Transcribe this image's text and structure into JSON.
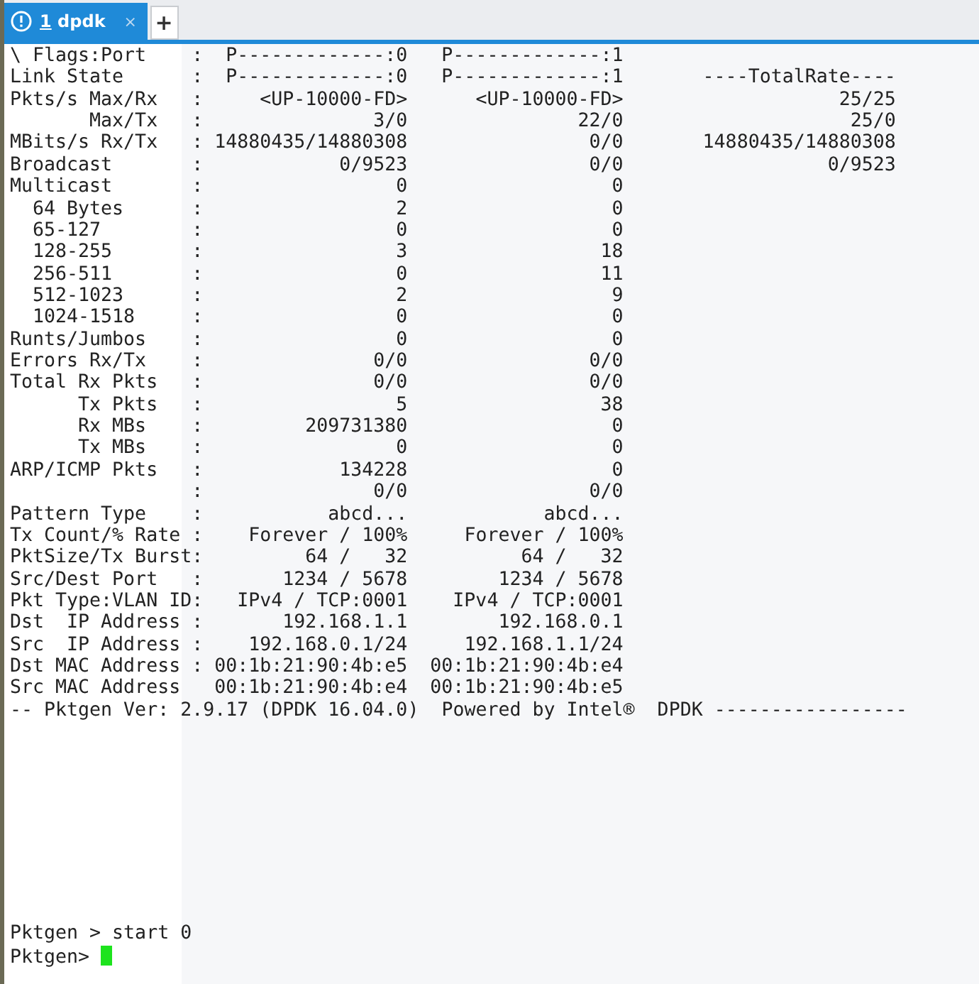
{
  "tabs": [
    {
      "number": "1",
      "label": "dpdk",
      "selected": true,
      "close": "×"
    }
  ],
  "new_tab": "+",
  "terminal": {
    "rows": [
      {
        "label": "\\ Flags:Port",
        "sep": ":",
        "port0": "P-------------:0",
        "port1": "P-------------:1"
      },
      {
        "label": "Link State",
        "sep": ":",
        "port0": "P-------------:0",
        "port1": "P-------------:1",
        "total": "----TotalRate----"
      },
      {
        "label": "Pkts/s Max/Rx",
        "sep": ":",
        "port0": "<UP-10000-FD>",
        "port1": "<UP-10000-FD>",
        "total": "25/25"
      },
      {
        "label": "       Max/Tx",
        "sep": ":",
        "port0": "3/0",
        "port1": "22/0",
        "total": "25/0"
      },
      {
        "label": "MBits/s Rx/Tx",
        "sep": ":",
        "port0": "14880435/14880308",
        "port1": "0/0",
        "total": "14880435/14880308"
      },
      {
        "label": "Broadcast",
        "sep": ":",
        "port0": "0/9523",
        "port1": "0/0",
        "total": "0/9523"
      },
      {
        "label": "Multicast",
        "sep": ":",
        "port0": "0",
        "port1": "0"
      },
      {
        "label": "  64 Bytes",
        "sep": ":",
        "port0": "2",
        "port1": "0"
      },
      {
        "label": "  65-127",
        "sep": ":",
        "port0": "0",
        "port1": "0"
      },
      {
        "label": "  128-255",
        "sep": ":",
        "port0": "3",
        "port1": "18"
      },
      {
        "label": "  256-511",
        "sep": ":",
        "port0": "0",
        "port1": "11"
      },
      {
        "label": "  512-1023",
        "sep": ":",
        "port0": "2",
        "port1": "9"
      },
      {
        "label": "  1024-1518",
        "sep": ":",
        "port0": "0",
        "port1": "0"
      },
      {
        "label": "Runts/Jumbos",
        "sep": ":",
        "port0": "0",
        "port1": "0"
      },
      {
        "label": "Errors Rx/Tx",
        "sep": ":",
        "port0": "0/0",
        "port1": "0/0"
      },
      {
        "label": "Total Rx Pkts",
        "sep": ":",
        "port0": "0/0",
        "port1": "0/0"
      },
      {
        "label": "      Tx Pkts",
        "sep": ":",
        "port0": "5",
        "port1": "38"
      },
      {
        "label": "      Rx MBs",
        "sep": ":",
        "port0": "209731380",
        "port1": "0"
      },
      {
        "label": "      Tx MBs",
        "sep": ":",
        "port0": "0",
        "port1": "0"
      },
      {
        "label": "ARP/ICMP Pkts",
        "sep": ":",
        "port0": "134228",
        "port1": "0"
      },
      {
        "sep": ":",
        "port0": "0/0",
        "port1": "0/0"
      },
      {
        "label": "Pattern Type",
        "sep": ":",
        "port0": "abcd...",
        "port1": "abcd..."
      },
      {
        "label": "Tx Count/% Rate",
        "sep": ":",
        "port0": "Forever / 100%",
        "port1": "Forever / 100%"
      },
      {
        "label": "PktSize/Tx Burst",
        "sep": ":",
        "port0": "64 /   32",
        "port1": "64 /   32"
      },
      {
        "label": "Src/Dest Port",
        "sep": ":",
        "port0": "1234 / 5678",
        "port1": "1234 / 5678"
      },
      {
        "label": "Pkt Type:VLAN ID",
        "sep": ":",
        "port0": "IPv4 / TCP:0001",
        "port1": "IPv4 / TCP:0001"
      },
      {
        "label": "Dst  IP Address",
        "sep": ":",
        "port0": "192.168.1.1",
        "port1": "192.168.0.1"
      },
      {
        "label": "Src  IP Address",
        "sep": ":",
        "port0": "192.168.0.1/24",
        "port1": "192.168.1.1/24"
      },
      {
        "label": "Dst MAC Address",
        "sep": ":",
        "port0": "00:1b:21:90:4b:e5",
        "port1": "00:1b:21:90:4b:e4"
      },
      {
        "label": "Src MAC Address",
        "port0": "00:1b:21:90:4b:e4",
        "port1": "00:1b:21:90:4b:e5"
      }
    ],
    "footer": "-- Pktgen Ver: 2.9.17 (DPDK 16.04.0)  Powered by Intel®  DPDK -----------------",
    "history": [
      "Pktgen > start 0"
    ],
    "prompt": "Pktgen>"
  }
}
